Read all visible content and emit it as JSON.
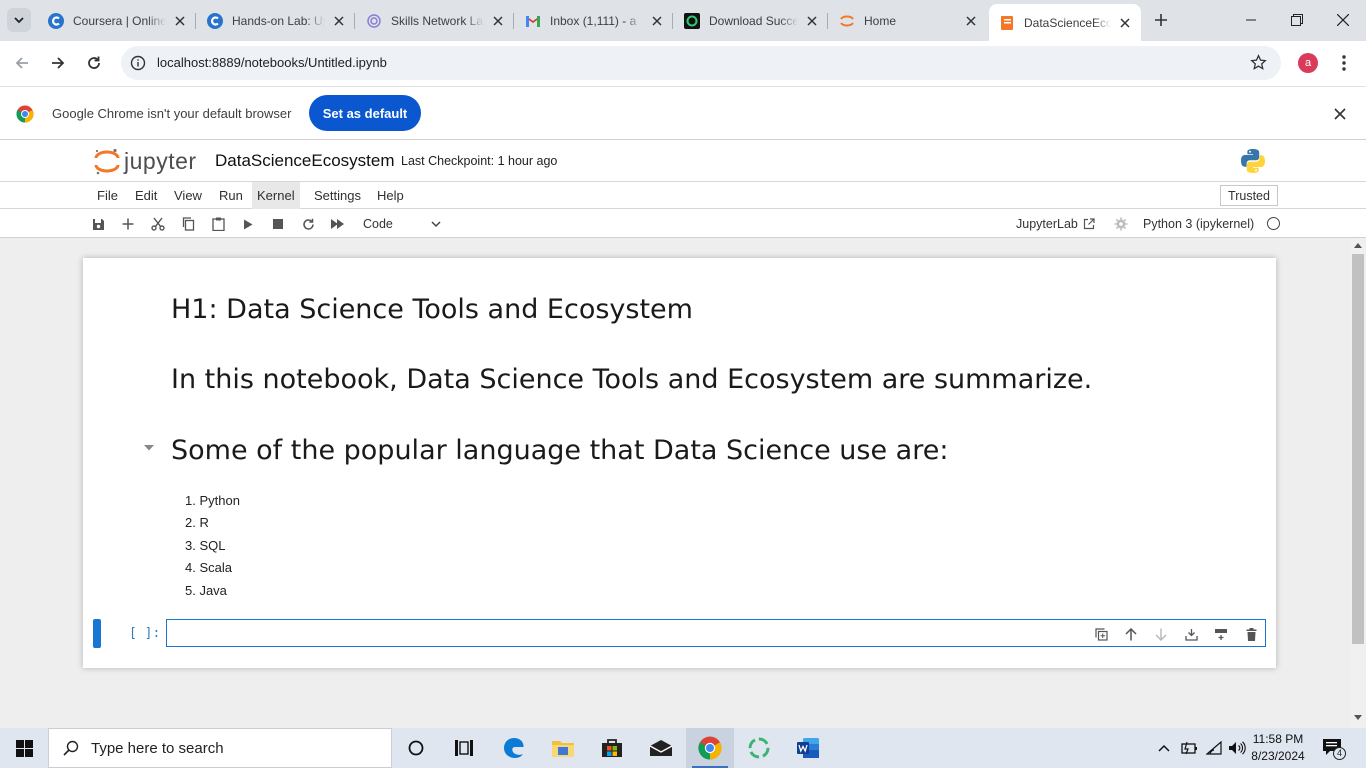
{
  "browser": {
    "tabs": [
      {
        "title": "Coursera | Online Courses",
        "icon": "coursera-icon",
        "active": false
      },
      {
        "title": "Hands-on Lab: Upload",
        "icon": "coursera-icon",
        "active": false
      },
      {
        "title": "Skills Network Labs",
        "icon": "skills-network-icon",
        "active": false
      },
      {
        "title": "Inbox (1,111) - a",
        "icon": "gmail-icon",
        "active": false
      },
      {
        "title": "Download Success",
        "icon": "download-success-icon",
        "active": false
      },
      {
        "title": "Home",
        "icon": "jupyter-icon",
        "active": false
      },
      {
        "title": "DataScienceEcosystem",
        "icon": "notebook-icon",
        "active": true
      }
    ],
    "url": "localhost:8889/notebooks/Untitled.ipynb",
    "profile_initial": "a",
    "infobar": {
      "message": "Google Chrome isn't your default browser",
      "button": "Set as default"
    }
  },
  "jupyter": {
    "logo_text": "jupyter",
    "notebook_title": "DataScienceEcosystem",
    "checkpoint": "Last Checkpoint: 1 hour ago",
    "menu": [
      "File",
      "Edit",
      "View",
      "Run",
      "Kernel",
      "Settings",
      "Help"
    ],
    "menu_highlighted": "Kernel",
    "trusted": "Trusted",
    "cell_type": "Code",
    "jupyterlab_link": "JupyterLab",
    "kernel": "Python 3 (ipykernel)"
  },
  "notebook": {
    "heading1": "H1: Data Science Tools and Ecosystem",
    "heading2": "In this notebook, Data Science Tools and Ecosystem are summarize.",
    "heading3": "Some of the popular language that Data Science use are:",
    "languages": [
      "1. Python",
      "2. R",
      "3. SQL",
      "4. Scala",
      "5. Java"
    ],
    "prompt": "[ ]:"
  },
  "taskbar": {
    "search_placeholder": "Type here to search",
    "time": "11:58 PM",
    "date": "8/23/2024",
    "notification_count": "4"
  },
  "colors": {
    "accent_blue": "#1976d2",
    "chrome_button": "#0b57d0",
    "jupyter_orange": "#f37726"
  }
}
